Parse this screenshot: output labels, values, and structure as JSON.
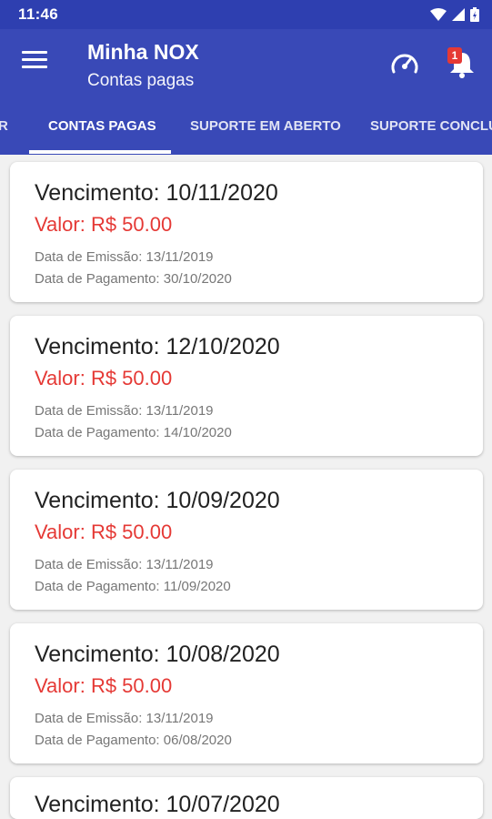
{
  "status_bar": {
    "time": "11:46",
    "icons": [
      "wifi-icon",
      "signal-icon",
      "battery-icon"
    ]
  },
  "app_bar": {
    "title": "Minha NOX",
    "subtitle": "Contas pagas",
    "notification_count": "1",
    "icons": [
      "menu-icon",
      "speedometer-icon",
      "bell-icon"
    ]
  },
  "tabs": [
    {
      "label": "R",
      "active": false
    },
    {
      "label": "CONTAS PAGAS",
      "active": true
    },
    {
      "label": "SUPORTE EM ABERTO",
      "active": false
    },
    {
      "label": "SUPORTE CONCLU",
      "active": false
    }
  ],
  "bills": [
    {
      "due": "Vencimento: 10/11/2020",
      "value": "Valor: R$ 50.00",
      "emission": "Data de Emissão: 13/11/2019",
      "payment": "Data de Pagamento: 30/10/2020"
    },
    {
      "due": "Vencimento: 12/10/2020",
      "value": "Valor: R$ 50.00",
      "emission": "Data de Emissão: 13/11/2019",
      "payment": "Data de Pagamento: 14/10/2020"
    },
    {
      "due": "Vencimento: 10/09/2020",
      "value": "Valor: R$ 50.00",
      "emission": "Data de Emissão: 13/11/2019",
      "payment": "Data de Pagamento: 11/09/2020"
    },
    {
      "due": "Vencimento: 10/08/2020",
      "value": "Valor: R$ 50.00",
      "emission": "Data de Emissão: 13/11/2019",
      "payment": "Data de Pagamento: 06/08/2020"
    },
    {
      "due": "Vencimento: 10/07/2020",
      "value": "",
      "emission": "",
      "payment": ""
    }
  ],
  "colors": {
    "primary": "#3949b7",
    "status_bar": "#2e3fb0",
    "value_red": "#e53935",
    "background": "#f1f1f1"
  }
}
